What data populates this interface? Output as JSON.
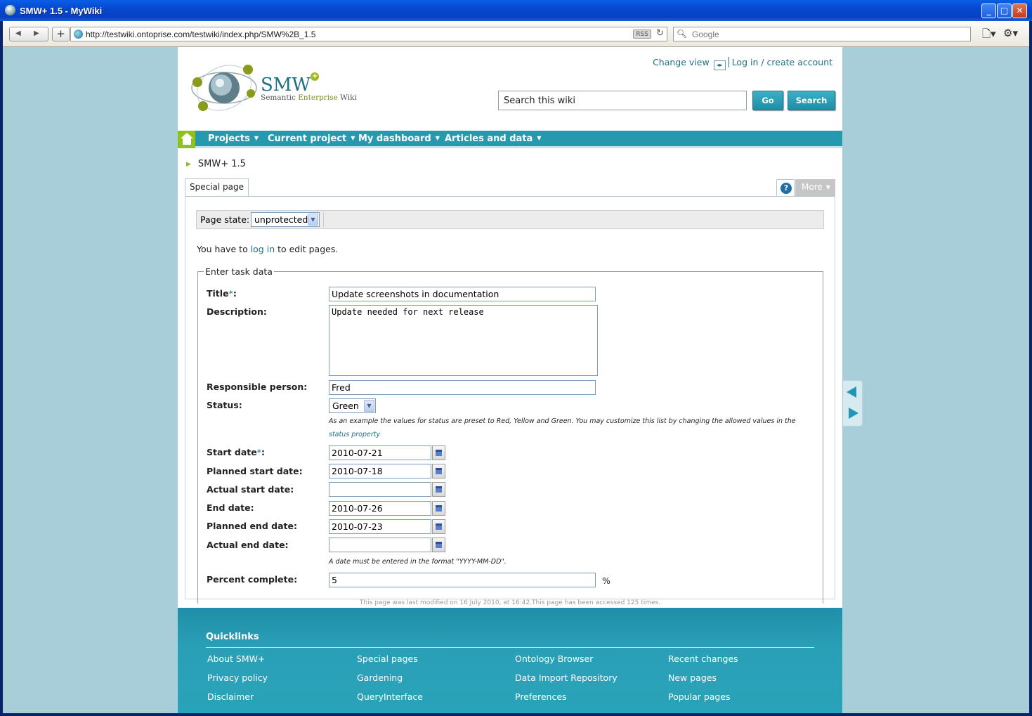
{
  "window": {
    "title": "SMW+ 1.5 - MyWiki",
    "controls": [
      "_",
      "□",
      "✕"
    ]
  },
  "browser": {
    "url": "http://testwiki.ontoprise.com/testwiki/index.php/SMW%2B_1.5",
    "rss_label": "RSS",
    "search_placeholder": "Google"
  },
  "header": {
    "logo_name": "SMW",
    "logo_subtitle_1": "Semantic",
    "logo_subtitle_2": "Enterprise",
    "logo_subtitle_3": "Wiki",
    "change_view": "Change view",
    "login": "Log in / create account",
    "search_value": "Search this wiki",
    "go_label": "Go",
    "search_label": "Search"
  },
  "menu": {
    "items": [
      "Projects",
      "Current project",
      "My dashboard",
      "Articles and data"
    ]
  },
  "breadcrumb": "SMW+ 1.5",
  "tabs": {
    "special_page": "Special page",
    "more": "More",
    "help": "?"
  },
  "state": {
    "label": "Page state:",
    "value": "unprotected"
  },
  "notice": {
    "before": "You have to ",
    "link": "log in",
    "after": " to edit pages."
  },
  "form": {
    "legend": "Enter task data",
    "title_label": "Title",
    "title_value": "Update screenshots in documentation",
    "description_label": "Description:",
    "description_value": "Update needed for next release",
    "responsible_label": "Responsible person:",
    "responsible_value": "Fred",
    "status_label": "Status:",
    "status_value": "Green",
    "status_note": "As an example the values for status are preset to Red, Yellow and Green. You may customize this list by changing the allowed values in the",
    "status_link": "status property",
    "start_label": "Start date",
    "start_value": "2010-07-21",
    "planned_start_label": "Planned start date:",
    "planned_start_value": "2010-07-18",
    "actual_start_label": "Actual start date:",
    "actual_start_value": "",
    "end_label": "End date:",
    "end_value": "2010-07-26",
    "planned_end_label": "Planned end date:",
    "planned_end_value": "2010-07-23",
    "actual_end_label": "Actual end date:",
    "actual_end_value": "",
    "date_note": "A date must be entered in the format \"YYYY-MM-DD\".",
    "percent_label": "Percent complete:",
    "percent_value": "5",
    "percent_unit": "%"
  },
  "last_modified": "This page was last modified on 16 July 2010, at 16:42.This page has been accessed 125 times.",
  "footer": {
    "title": "Quicklinks",
    "links": [
      [
        "About SMW+",
        "Privacy policy",
        "Disclaimer"
      ],
      [
        "Special pages",
        "Gardening",
        "QueryInterface"
      ],
      [
        "Ontology Browser",
        "Data Import Repository",
        "Preferences"
      ],
      [
        "Recent changes",
        "New pages",
        "Popular pages"
      ]
    ]
  },
  "colors": {
    "accent": "#2699af",
    "home": "#8ec21a",
    "link": "#1f6f84",
    "background": "#a7ced9"
  }
}
